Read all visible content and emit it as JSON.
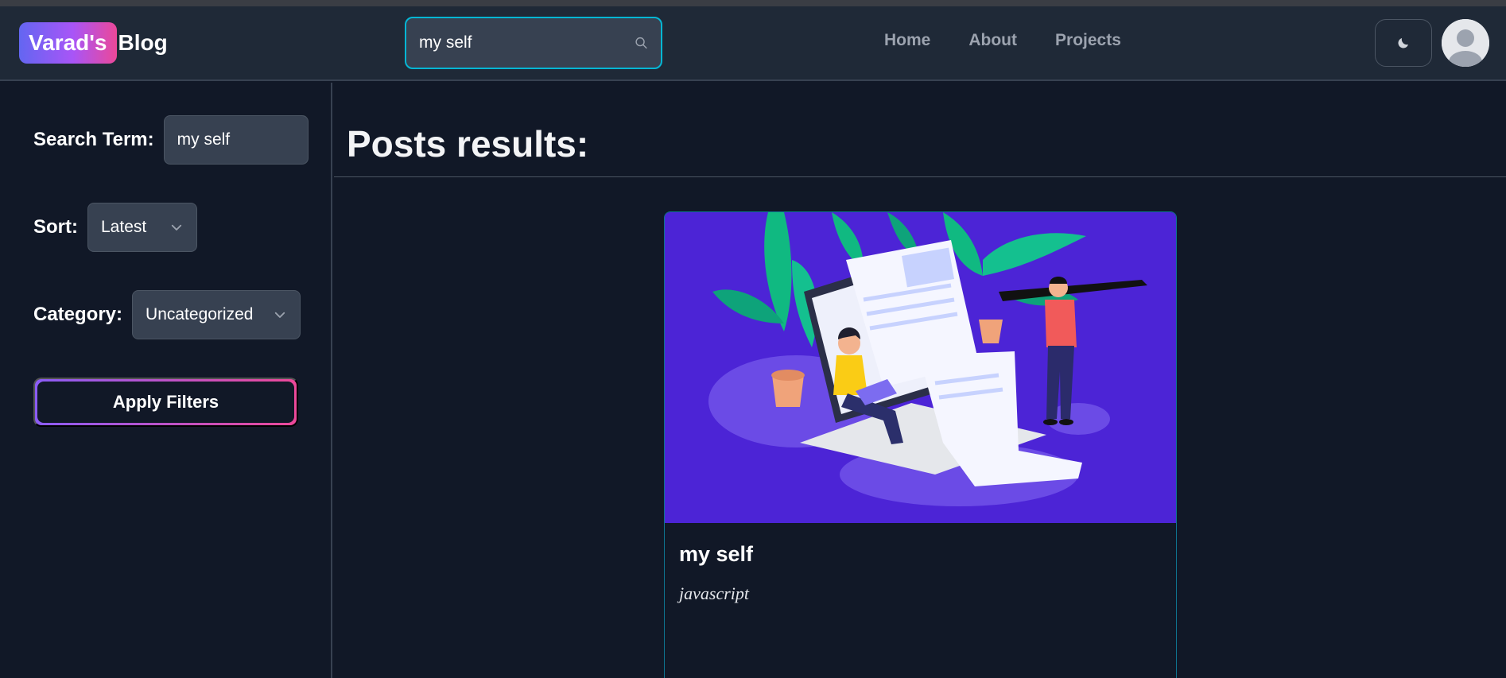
{
  "header": {
    "logo_badge": "Varad's",
    "logo_text": "Blog",
    "search": {
      "value": "my self",
      "icon": "search-icon"
    },
    "nav": [
      {
        "label": "Home"
      },
      {
        "label": "About"
      },
      {
        "label": "Projects"
      }
    ],
    "theme_toggle_icon": "moon-icon",
    "avatar_icon": "user-avatar-icon"
  },
  "sidebar": {
    "search_term": {
      "label": "Search Term:",
      "value": "my self"
    },
    "sort": {
      "label": "Sort:",
      "value": "Latest"
    },
    "category": {
      "label": "Category:",
      "value": "Uncategorized"
    },
    "apply_label": "Apply Filters"
  },
  "main": {
    "title": "Posts results:",
    "posts": [
      {
        "title": "my self",
        "category": "javascript"
      }
    ]
  },
  "colors": {
    "background": "#111827",
    "header": "#1f2937",
    "accent_cyan": "#06b6d4",
    "gradient_start": "#8b5cf6",
    "gradient_end": "#ec4899",
    "card_image_bg": "#4c24d6"
  }
}
